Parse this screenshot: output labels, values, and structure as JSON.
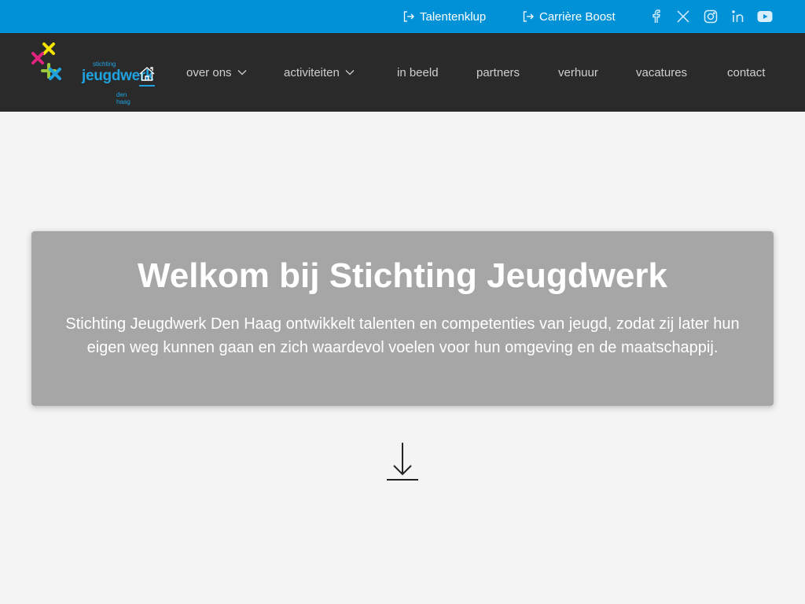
{
  "topbar": {
    "links": [
      {
        "label": "Talentenklup",
        "icon": "login-icon"
      },
      {
        "label": "Carrière Boost",
        "icon": "login-icon"
      }
    ],
    "social": [
      "facebook-icon",
      "x-icon",
      "instagram-icon",
      "linkedin-icon",
      "youtube-icon"
    ],
    "color": "#0091d7"
  },
  "logo": {
    "small_top": "stichting",
    "main": "jeugdwerk",
    "small_bottom": "den haag"
  },
  "nav": {
    "items": [
      {
        "label": "over ons",
        "dropdown": true
      },
      {
        "label": "activiteiten",
        "dropdown": true
      },
      {
        "label": "in beeld"
      },
      {
        "label": "partners"
      },
      {
        "label": "verhuur"
      },
      {
        "label": "vacatures"
      },
      {
        "label": "contact"
      }
    ],
    "home_icon": "home-icon",
    "active_color": "#1fa3e0",
    "background": "#2a2a2a"
  },
  "hero": {
    "title": "Welkom bij Stichting Jeugdwerk",
    "text": "Stichting Jeugdwerk Den Haag ontwikkelt talenten en competenties van jeugd, zodat zij later hun eigen weg kunnen gaan en zich waardevol voelen voor hun omgeving en de maatschappij."
  },
  "scroll_icon": "arrow-down-to-line-icon"
}
